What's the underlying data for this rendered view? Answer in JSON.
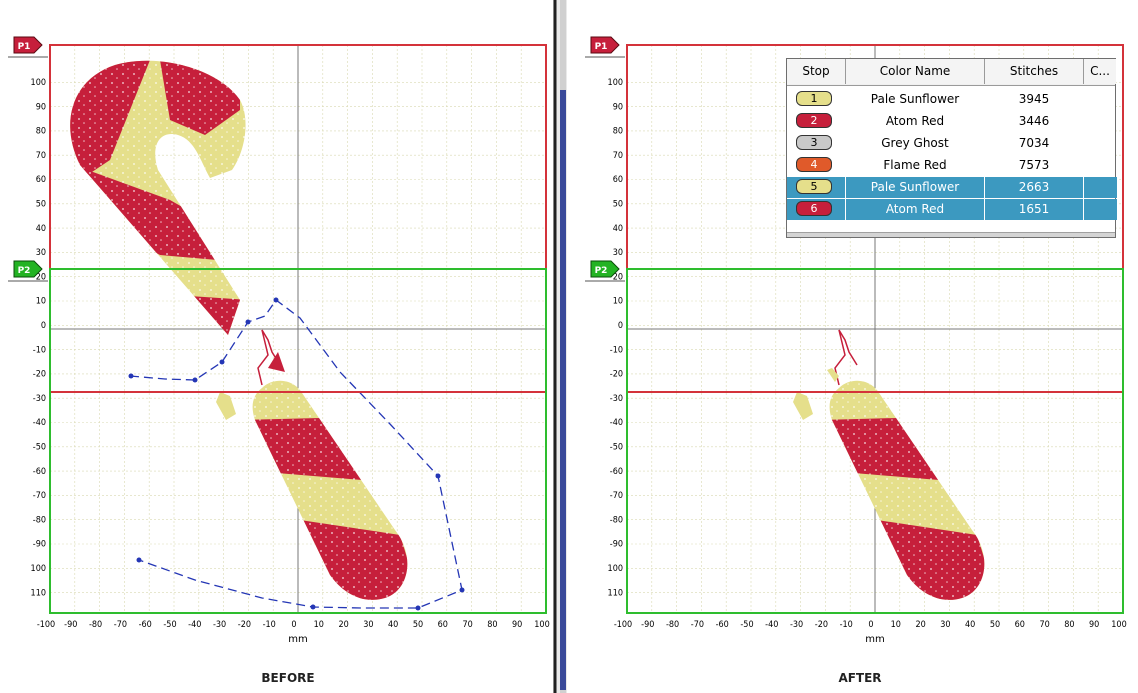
{
  "colors": {
    "yellow": "#e5df8b",
    "red": "#c61f3b",
    "grey": "#c9c9c9",
    "flame": "#e05a2a",
    "frame_red": "#d4323a",
    "frame_green": "#2ebd2e",
    "path_blue": "#2436b5",
    "grid": "#d9d9b2",
    "selection": "#3c99c0"
  },
  "panels": [
    {
      "caption": "BEFORE",
      "axis_unit": "mm",
      "x_ticks": [
        "-100",
        "-90",
        "-80",
        "-70",
        "-60",
        "-50",
        "-40",
        "-30",
        "-20",
        "-10",
        "0",
        "10",
        "20",
        "30",
        "40",
        "50",
        "60",
        "70",
        "80",
        "90",
        "100"
      ],
      "y_ticks": [
        "100",
        "90",
        "80",
        "70",
        "60",
        "50",
        "40",
        "30",
        "20",
        "10",
        "0",
        "-10",
        "-20",
        "-30",
        "-40",
        "-50",
        "-60",
        "-70",
        "-80",
        "-90",
        "100",
        "110"
      ],
      "markers": [
        {
          "label": "P1",
          "color": "#c61f3b"
        },
        {
          "label": "P2",
          "color": "#23b323"
        }
      ]
    },
    {
      "caption": "AFTER",
      "axis_unit": "mm",
      "x_ticks": [
        "-100",
        "-90",
        "-80",
        "-70",
        "-60",
        "-50",
        "-40",
        "-30",
        "-20",
        "-10",
        "0",
        "10",
        "20",
        "30",
        "40",
        "50",
        "60",
        "70",
        "80",
        "90",
        "100"
      ],
      "y_ticks": [
        "100",
        "90",
        "80",
        "70",
        "60",
        "50",
        "40",
        "30",
        "20",
        "10",
        "0",
        "-10",
        "-20",
        "-30",
        "-40",
        "-50",
        "-60",
        "-70",
        "-80",
        "-90",
        "100",
        "110"
      ],
      "markers": [
        {
          "label": "P1",
          "color": "#c61f3b"
        },
        {
          "label": "P2",
          "color": "#23b323"
        }
      ]
    }
  ],
  "stop_table": {
    "headers": [
      "Stop",
      "Color Name",
      "Stitches",
      "C..."
    ],
    "rows": [
      {
        "stop": "1",
        "name": "Pale Sunflower",
        "stitches": "3945",
        "chip": "#e5df8b",
        "selected": false
      },
      {
        "stop": "2",
        "name": "Atom Red",
        "stitches": "3446",
        "chip": "#c61f3b",
        "selected": false
      },
      {
        "stop": "3",
        "name": "Grey Ghost",
        "stitches": "7034",
        "chip": "#c9c9c9",
        "selected": false
      },
      {
        "stop": "4",
        "name": "Flame Red",
        "stitches": "7573",
        "chip": "#e05a2a",
        "selected": false
      },
      {
        "stop": "5",
        "name": "Pale Sunflower",
        "stitches": "2663",
        "chip": "#e5df8b",
        "selected": true
      },
      {
        "stop": "6",
        "name": "Atom Red",
        "stitches": "1651",
        "chip": "#c61f3b",
        "selected": true
      }
    ]
  }
}
